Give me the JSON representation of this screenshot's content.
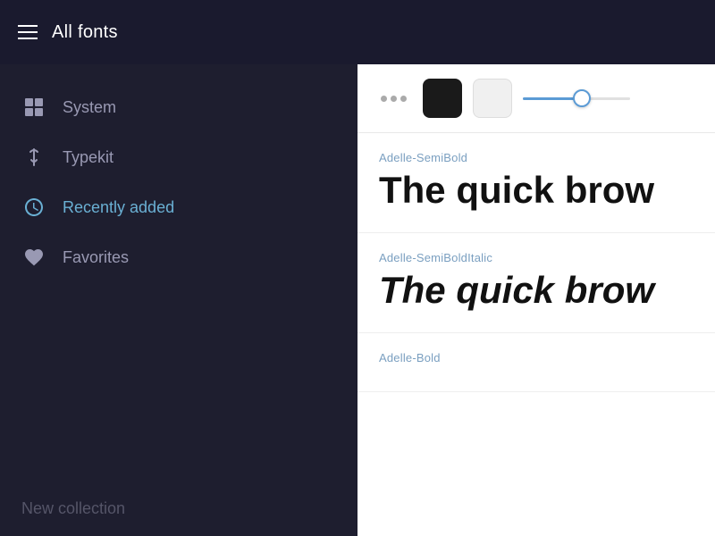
{
  "header": {
    "title": "All fonts",
    "hamburger_label": "Menu"
  },
  "sidebar": {
    "items": [
      {
        "id": "system",
        "label": "System",
        "icon": "windows-icon",
        "active": false
      },
      {
        "id": "typekit",
        "label": "Typekit",
        "icon": "typekit-icon",
        "active": false
      },
      {
        "id": "recently-added",
        "label": "Recently added",
        "icon": "clock-icon",
        "active": true
      },
      {
        "id": "favorites",
        "label": "Favorites",
        "icon": "heart-icon",
        "active": false
      }
    ],
    "new_collection_label": "New collection"
  },
  "toolbar": {
    "dots_label": "Options",
    "dark_swatch_label": "Dark color",
    "light_swatch_label": "Light color",
    "slider_label": "Size slider",
    "slider_value": 55
  },
  "fonts": [
    {
      "name": "Adelle-SemiBold",
      "preview": "The quick brow",
      "style": "semi-bold"
    },
    {
      "name": "Adelle-SemiBoldItalic",
      "preview": "The quick brow",
      "style": "semi-bold-italic"
    },
    {
      "name": "Adelle-Bold",
      "preview": "",
      "style": "bold"
    }
  ]
}
